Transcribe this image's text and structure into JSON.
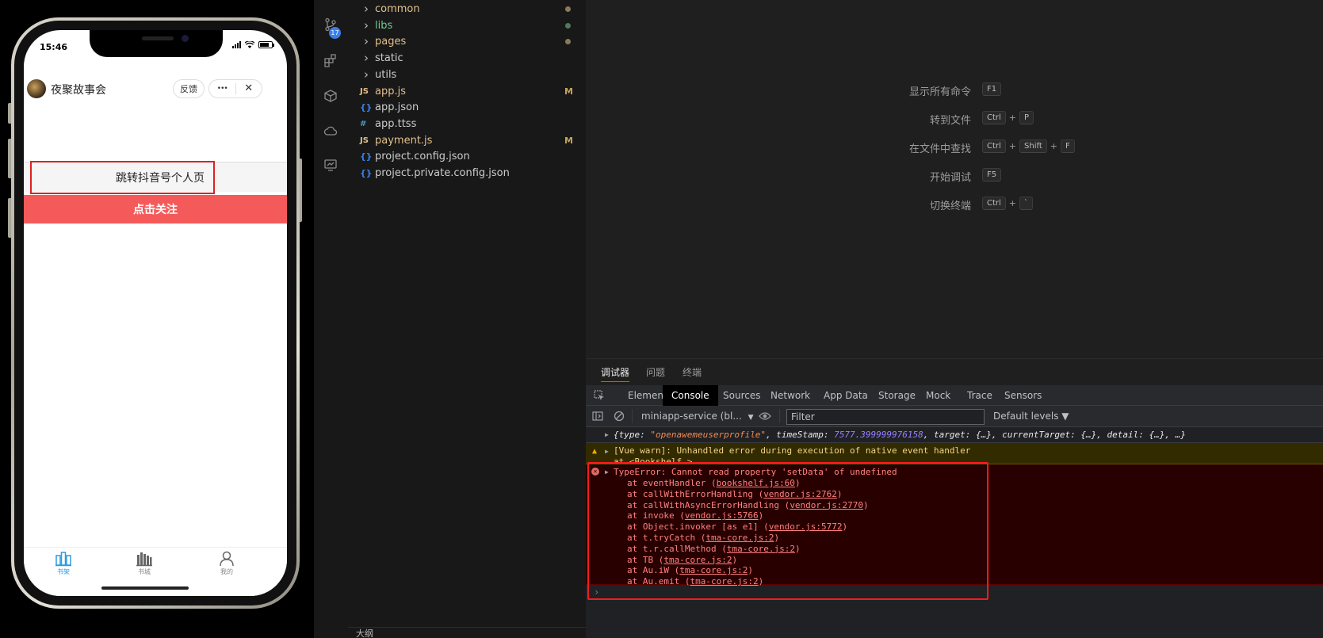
{
  "phone": {
    "time": "15:46",
    "app_title": "夜聚故事会",
    "feedback_label": "反馈",
    "more_label": "•••",
    "close_label": "✕",
    "jump_button_label": "跳转抖音号个人页",
    "follow_button_label": "点击关注",
    "tabs": [
      {
        "label": "书架",
        "icon": "bookshelf-icon",
        "active": true
      },
      {
        "label": "书城",
        "icon": "bookstore-icon",
        "active": false
      },
      {
        "label": "我的",
        "icon": "user-icon",
        "active": false
      }
    ],
    "colors": {
      "follow_bg": "#f55a5a",
      "active_tab": "#2e9bdc",
      "highlight": "#e02020"
    }
  },
  "activity_bar": {
    "scm_badge": "17"
  },
  "explorer": {
    "items": [
      {
        "name": "common",
        "type": "folder",
        "color": "#e2c08d",
        "status": "dot",
        "dot_color": "#8a7a5a"
      },
      {
        "name": "libs",
        "type": "folder",
        "color": "#73c991",
        "status": "dot",
        "dot_color": "#4f7a5c"
      },
      {
        "name": "pages",
        "type": "folder",
        "color": "#e2c08d",
        "status": "dot",
        "dot_color": "#8a7a5a"
      },
      {
        "name": "static",
        "type": "folder",
        "color": "#cccccc",
        "status": ""
      },
      {
        "name": "utils",
        "type": "folder",
        "color": "#cccccc",
        "status": ""
      },
      {
        "name": "app.js",
        "type": "js",
        "color": "#e2c08d",
        "status": "M"
      },
      {
        "name": "app.json",
        "type": "json",
        "color": "#cccccc",
        "status": ""
      },
      {
        "name": "app.ttss",
        "type": "css",
        "color": "#cccccc",
        "status": ""
      },
      {
        "name": "payment.js",
        "type": "js",
        "color": "#e2c08d",
        "status": "M"
      },
      {
        "name": "project.config.json",
        "type": "json",
        "color": "#cccccc",
        "status": ""
      },
      {
        "name": "project.private.config.json",
        "type": "json",
        "color": "#cccccc",
        "status": ""
      }
    ],
    "icons": {
      "js": "JS",
      "json": "{ }",
      "css": "#"
    },
    "outline_label": "大纲"
  },
  "editor": {
    "shortcuts": [
      {
        "label": "显示所有命令",
        "keys": [
          "F1"
        ]
      },
      {
        "label": "转到文件",
        "keys": [
          "Ctrl",
          "P"
        ]
      },
      {
        "label": "在文件中查找",
        "keys": [
          "Ctrl",
          "Shift",
          "F"
        ]
      },
      {
        "label": "开始调试",
        "keys": [
          "F5"
        ]
      },
      {
        "label": "切换终端",
        "keys": [
          "Ctrl",
          "`"
        ]
      }
    ]
  },
  "panel": {
    "tabs": [
      "调试器",
      "问题",
      "终端"
    ],
    "devtools_tabs": [
      "Elements",
      "Console",
      "Sources",
      "Network",
      "App Data",
      "Storage",
      "Mock",
      "Trace",
      "Sensors"
    ],
    "active_devtools_tab": "Console",
    "context_select": "miniapp-service (bl...",
    "filter_placeholder": "Filter",
    "levels_label": "Default levels ▼",
    "log_line": {
      "k1": "{type: ",
      "v1": "\"openawemeuserprofile\"",
      "k2": ", timeStamp: ",
      "v2": "7577.399999976158",
      "rest": ", target: {…}, currentTarget: {…}, detail: {…}, …}"
    },
    "warning": {
      "line1": "[Vue warn]: Unhandled error during execution of native event handler",
      "line2": "  at <Bookshelf >"
    },
    "error": {
      "message": "TypeError: Cannot read property 'setData' of undefined",
      "frames": [
        {
          "fn": "at eventHandler (",
          "loc": "bookshelf.js:60"
        },
        {
          "fn": "at callWithErrorHandling (",
          "loc": "vendor.js:2762"
        },
        {
          "fn": "at callWithAsyncErrorHandling (",
          "loc": "vendor.js:2770"
        },
        {
          "fn": "at invoke (",
          "loc": "vendor.js:5766"
        },
        {
          "fn": "at Object.invoker [as e1] (",
          "loc": "vendor.js:5772"
        },
        {
          "fn": "at t.tryCatch (",
          "loc": "tma-core.js:2"
        },
        {
          "fn": "at t.r.callMethod (",
          "loc": "tma-core.js:2"
        },
        {
          "fn": "at TB (",
          "loc": "tma-core.js:2"
        },
        {
          "fn": "at Au.iW (",
          "loc": "tma-core.js:2"
        },
        {
          "fn": "at Au.emit (",
          "loc": "tma-core.js:2"
        }
      ]
    },
    "prompt": "›"
  }
}
